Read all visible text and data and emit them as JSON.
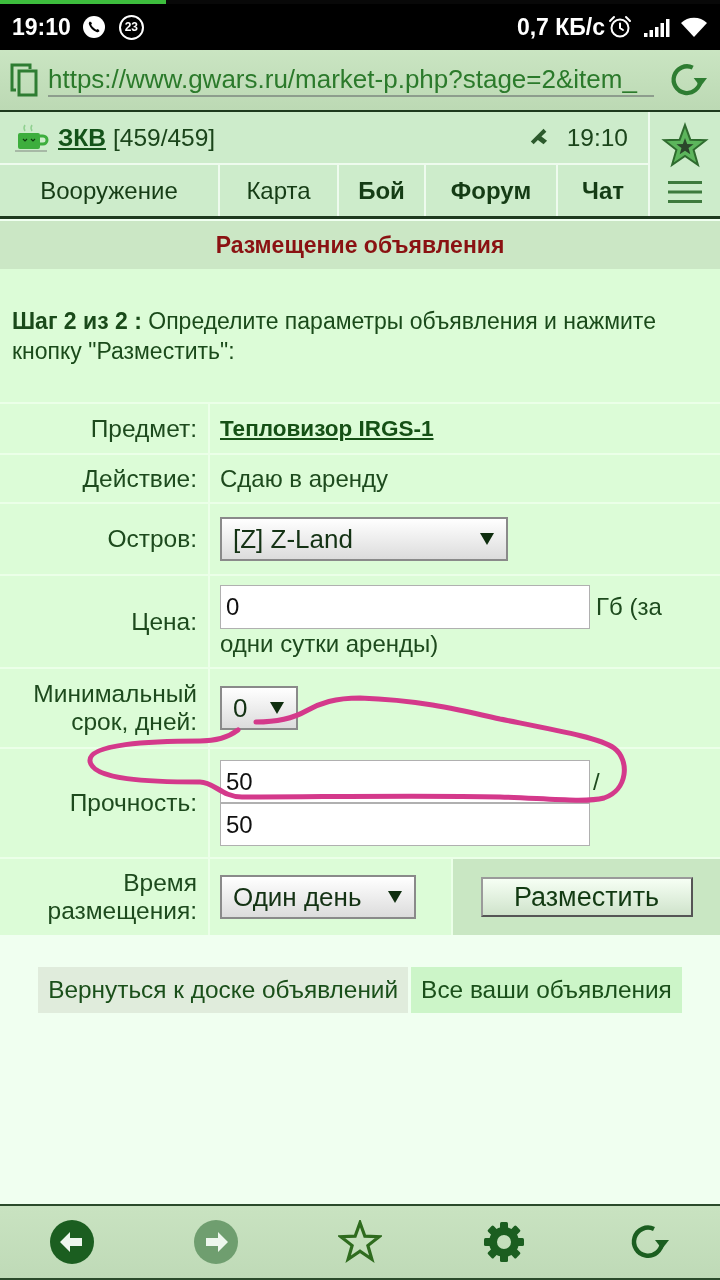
{
  "status_bar": {
    "time": "19:10",
    "notification_count": "23",
    "network_speed": "0,7 КБ/с"
  },
  "browser": {
    "load_progress": {
      "level": 0.23
    },
    "url": "https://www.gwars.ru/market-p.php?stage=2&item_"
  },
  "header": {
    "user": {
      "name": "ЗКВ",
      "hp": "[459/459]"
    },
    "time": "19:10",
    "nav": [
      {
        "label": "Вооружение",
        "bold": false
      },
      {
        "label": "Карта",
        "bold": false
      },
      {
        "label": "Бой",
        "bold": true
      },
      {
        "label": "Форум",
        "bold": true
      },
      {
        "label": "Чат",
        "bold": true
      }
    ]
  },
  "page": {
    "title": "Размещение объявления",
    "intro": "**Шаг 2 из 2 :** Определите параметры объявления и нажмите кнопку \"Разместить\":",
    "form": [
      {
        "kind": "link",
        "label": "Предмет:",
        "value": "Тепловизор IRGS-1"
      },
      {
        "kind": "text",
        "label": "Действие:",
        "value": "Сдаю в аренду"
      },
      {
        "kind": "select",
        "label": "Остров:",
        "value": "[Z] Z-Land"
      },
      {
        "kind": "input",
        "label": "Цена:",
        "value": "0",
        "suffix": [
          "Гб (за",
          "одни сутки аренды)"
        ]
      },
      {
        "kind": "select",
        "label": "Минимальный срок, дней:",
        "value": "0"
      },
      {
        "kind": "pair",
        "label": "Прочность:",
        "values": [
          "50",
          "50"
        ],
        "separator": "/"
      },
      {
        "kind": "select_submit",
        "label": "Время размещения:",
        "value": "Один день",
        "button": "Разместить"
      }
    ],
    "links": [
      {
        "label": "Вернуться к доске объявлений",
        "highlighted": false
      },
      {
        "label": "Все ваши объявления",
        "highlighted": true
      }
    ]
  },
  "toolbar": {
    "buttons": [
      {
        "kind": "back",
        "disabled": false
      },
      {
        "kind": "forward",
        "disabled": true
      },
      {
        "kind": "bookmark",
        "disabled": false
      },
      {
        "kind": "settings",
        "disabled": false
      },
      {
        "kind": "reload",
        "disabled": false
      }
    ]
  }
}
